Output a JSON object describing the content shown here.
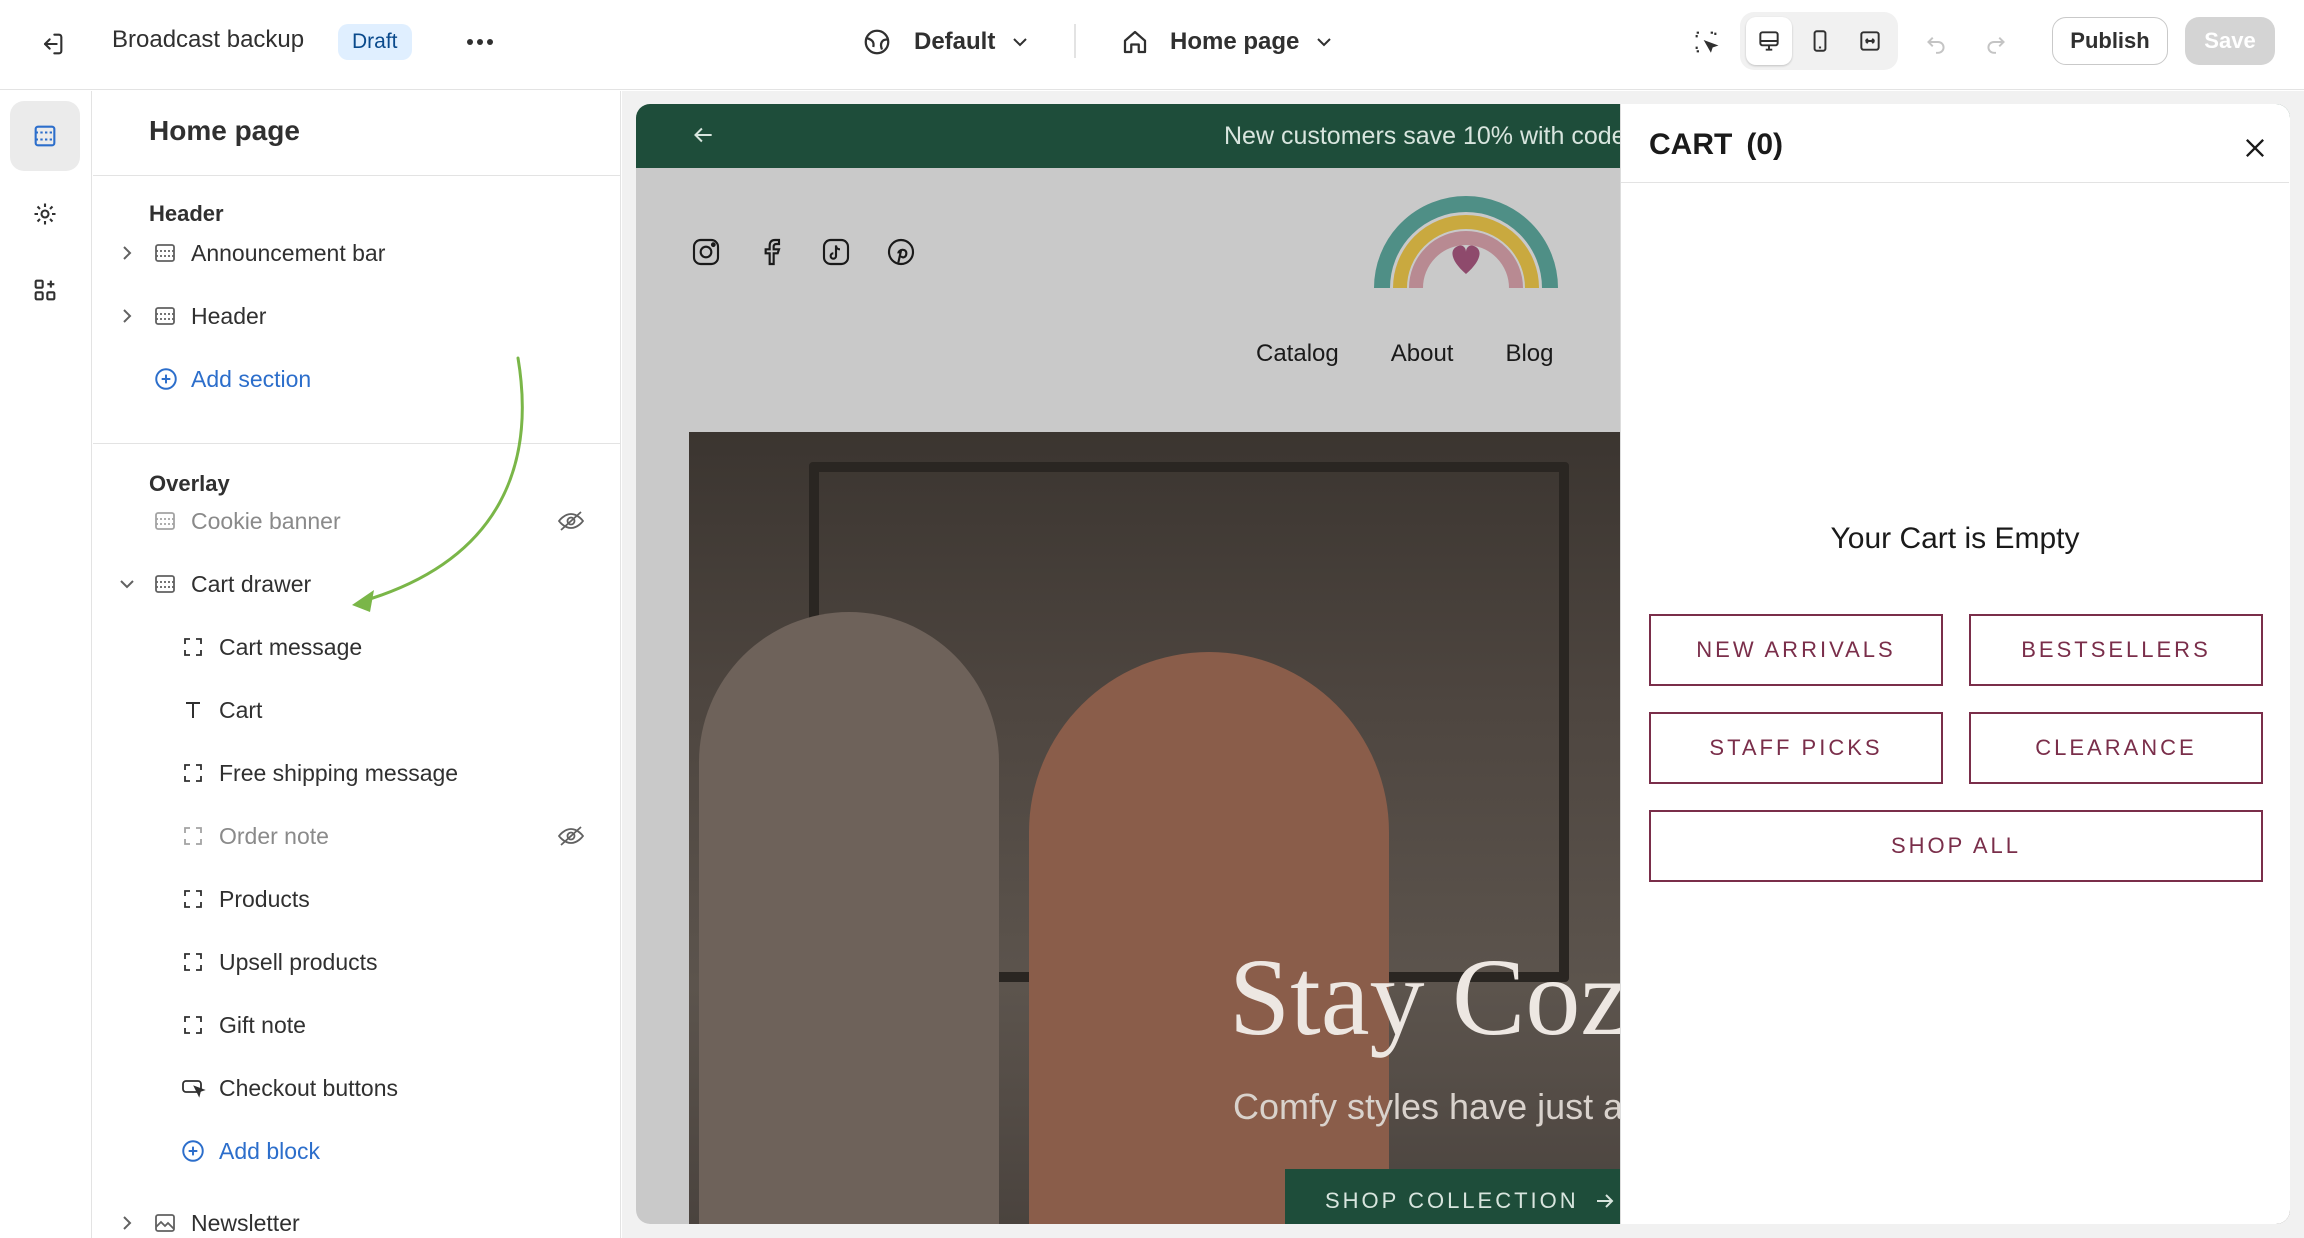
{
  "topbar": {
    "store_name": "Broadcast backup",
    "status_badge": "Draft",
    "theme_selector": "Default",
    "page_selector": "Home page",
    "publish_label": "Publish",
    "save_label": "Save"
  },
  "sidebar": {
    "title": "Home page",
    "header_group": "Header",
    "header_items": [
      "Announcement bar",
      "Header"
    ],
    "add_section": "Add section",
    "overlay_group": "Overlay",
    "overlay_items": [
      "Cookie banner",
      "Cart drawer"
    ],
    "cart_blocks": [
      "Cart message",
      "Cart",
      "Free shipping message",
      "Order note",
      "Products",
      "Upsell products",
      "Gift note",
      "Checkout buttons"
    ],
    "add_block": "Add block",
    "next_item": "Newsletter"
  },
  "preview": {
    "announcement": "New customers save 10% with code",
    "nav": [
      "Catalog",
      "About",
      "Blog"
    ],
    "hero_title": "Stay Coz",
    "hero_subtitle": "Comfy styles have just ar",
    "hero_button": "SHOP COLLECTION"
  },
  "cart": {
    "title": "CART",
    "count": "(0)",
    "empty_message": "Your Cart is Empty",
    "buttons": [
      "NEW ARRIVALS",
      "BESTSELLERS",
      "STAFF PICKS",
      "CLEARANCE",
      "SHOP ALL"
    ]
  },
  "colors": {
    "accent": "#2c6ecb",
    "announcement_bg": "#1e4d3a",
    "cart_button": "#7a2e4a",
    "annotation_arrow": "#7ab648"
  },
  "icons": {
    "exit": "exit-icon",
    "more": "more-horizontal-icon",
    "theme": "globe-icon",
    "home": "home-icon",
    "inspector": "inspector-icon",
    "desktop": "desktop-icon",
    "mobile": "mobile-icon",
    "fullwidth": "fullwidth-icon",
    "undo": "undo-icon",
    "redo": "redo-icon",
    "close": "close-icon"
  }
}
